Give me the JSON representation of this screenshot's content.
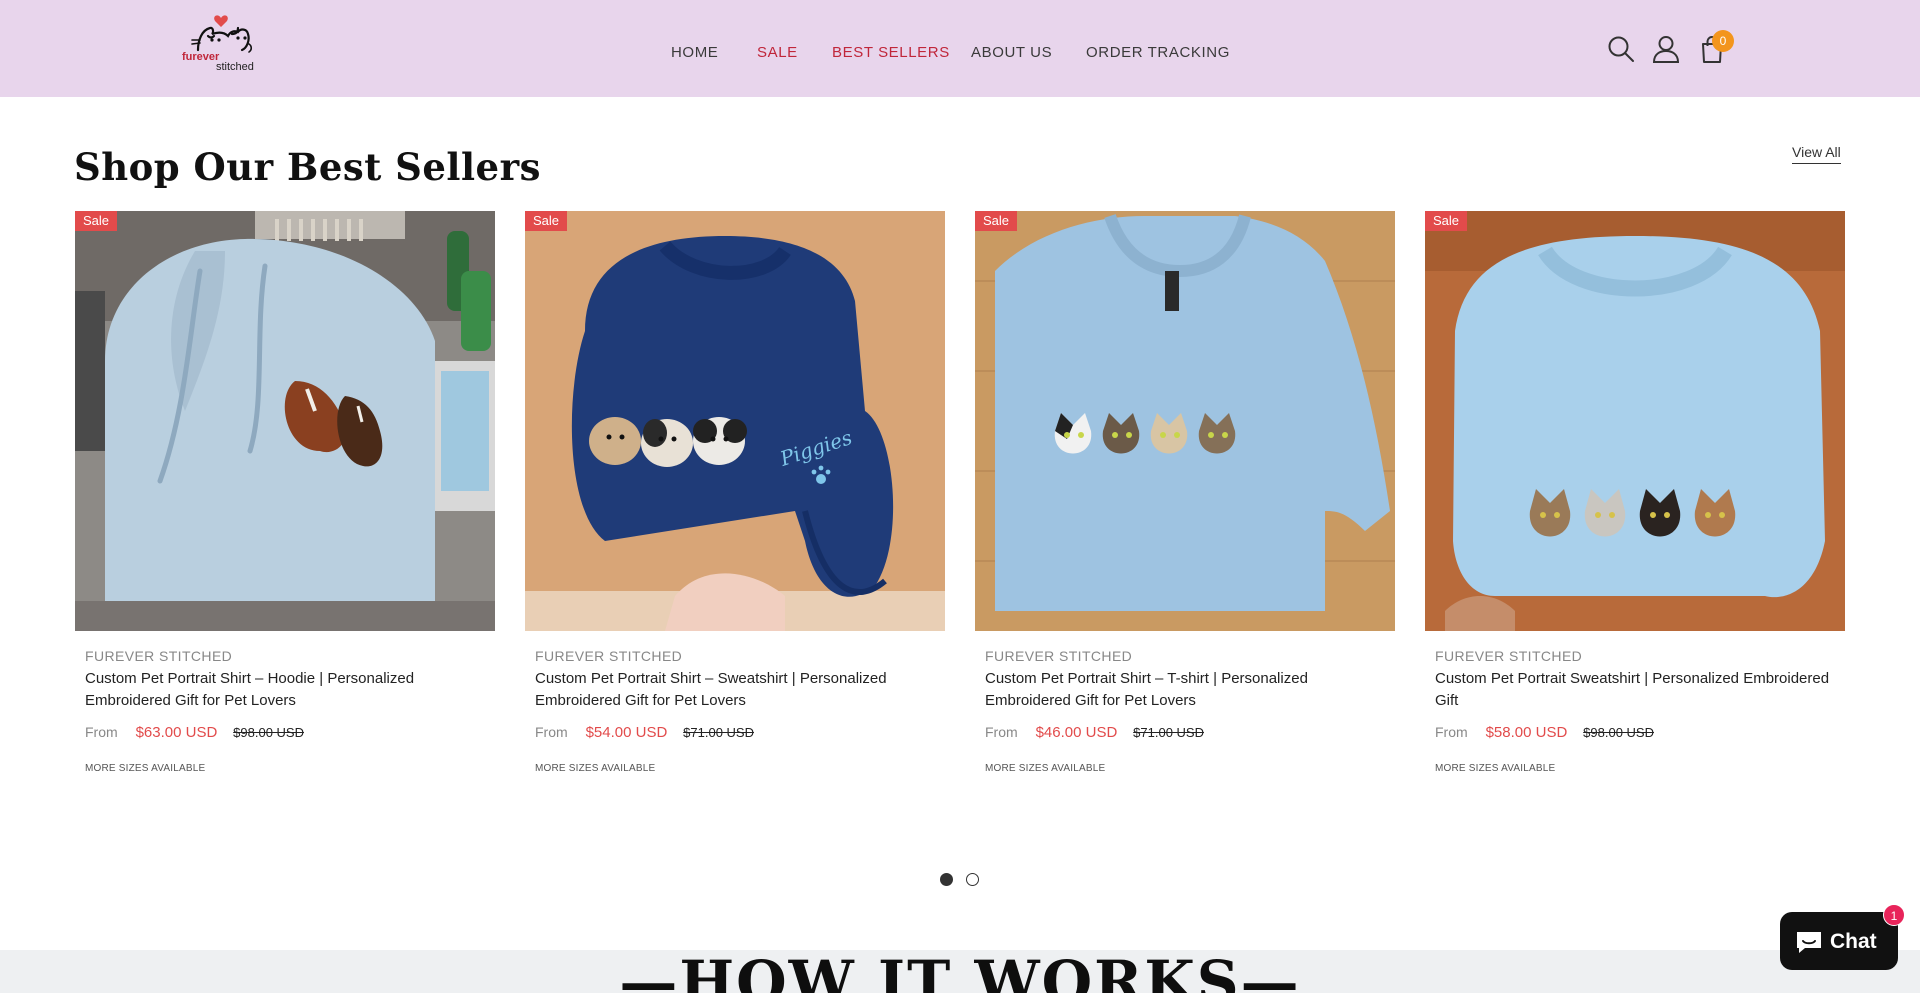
{
  "header": {
    "logo": {
      "word1": "furever",
      "word2": "stitched"
    },
    "nav": [
      {
        "label": "HOME",
        "color": "#3a3a3a"
      },
      {
        "label": "SALE",
        "color": "#c0263a"
      },
      {
        "label": "BEST SELLERS",
        "color": "#c0263a"
      },
      {
        "label": "ABOUT US",
        "color": "#3a3a3a"
      },
      {
        "label": "ORDER TRACKING",
        "color": "#3a3a3a"
      }
    ],
    "icons": [
      "search-icon",
      "account-icon",
      "cart-icon"
    ],
    "cart_count": "0",
    "background": "#e8d5ec"
  },
  "section": {
    "title": "Shop Our Best Sellers",
    "view_all": "View All"
  },
  "products": [
    {
      "badge": "Sale",
      "vendor": "FUREVER STITCHED",
      "title": "Custom Pet Portrait Shirt – Hoodie | Personalized Embroidered Gift for Pet Lovers",
      "from": "From",
      "price": "$63.00 USD",
      "compare_price": "$98.00 USD",
      "sizes": "MORE SIZES AVAILABLE",
      "image": "light blue hoodie with embroidered horses"
    },
    {
      "badge": "Sale",
      "vendor": "FUREVER STITCHED",
      "title": "Custom Pet Portrait Shirt – Sweatshirt | Personalized Embroidered Gift for Pet Lovers",
      "from": "From",
      "price": "$54.00 USD",
      "compare_price": "$71.00 USD",
      "sizes": "MORE SIZES AVAILABLE",
      "image": "navy sweatshirt with embroidered guinea pigs",
      "sleeve_text": "Piggies"
    },
    {
      "badge": "Sale",
      "vendor": "FUREVER STITCHED",
      "title": "Custom Pet Portrait Shirt – T-shirt | Personalized Embroidered Gift for Pet Lovers",
      "from": "From",
      "price": "$46.00 USD",
      "compare_price": "$71.00 USD",
      "sizes": "MORE SIZES AVAILABLE",
      "image": "light blue t-shirt with embroidered cats"
    },
    {
      "badge": "Sale",
      "vendor": "FUREVER STITCHED",
      "title": "Custom Pet Portrait Sweatshirt | Personalized Embroidered Gift",
      "from": "From",
      "price": "$58.00 USD",
      "compare_price": "$98.00 USD",
      "sizes": "MORE SIZES AVAILABLE",
      "image": "light blue sweatshirt with embroidered cats"
    }
  ],
  "carousel": {
    "pages": 2,
    "active": 1
  },
  "how_it_works": {
    "title": "—HOW IT WORKS—"
  },
  "chat": {
    "label": "Chat",
    "badge": "1"
  },
  "colors": {
    "sale_red": "#e24b4b",
    "brand_red": "#c0263a",
    "badge_orange": "#f3951d"
  }
}
